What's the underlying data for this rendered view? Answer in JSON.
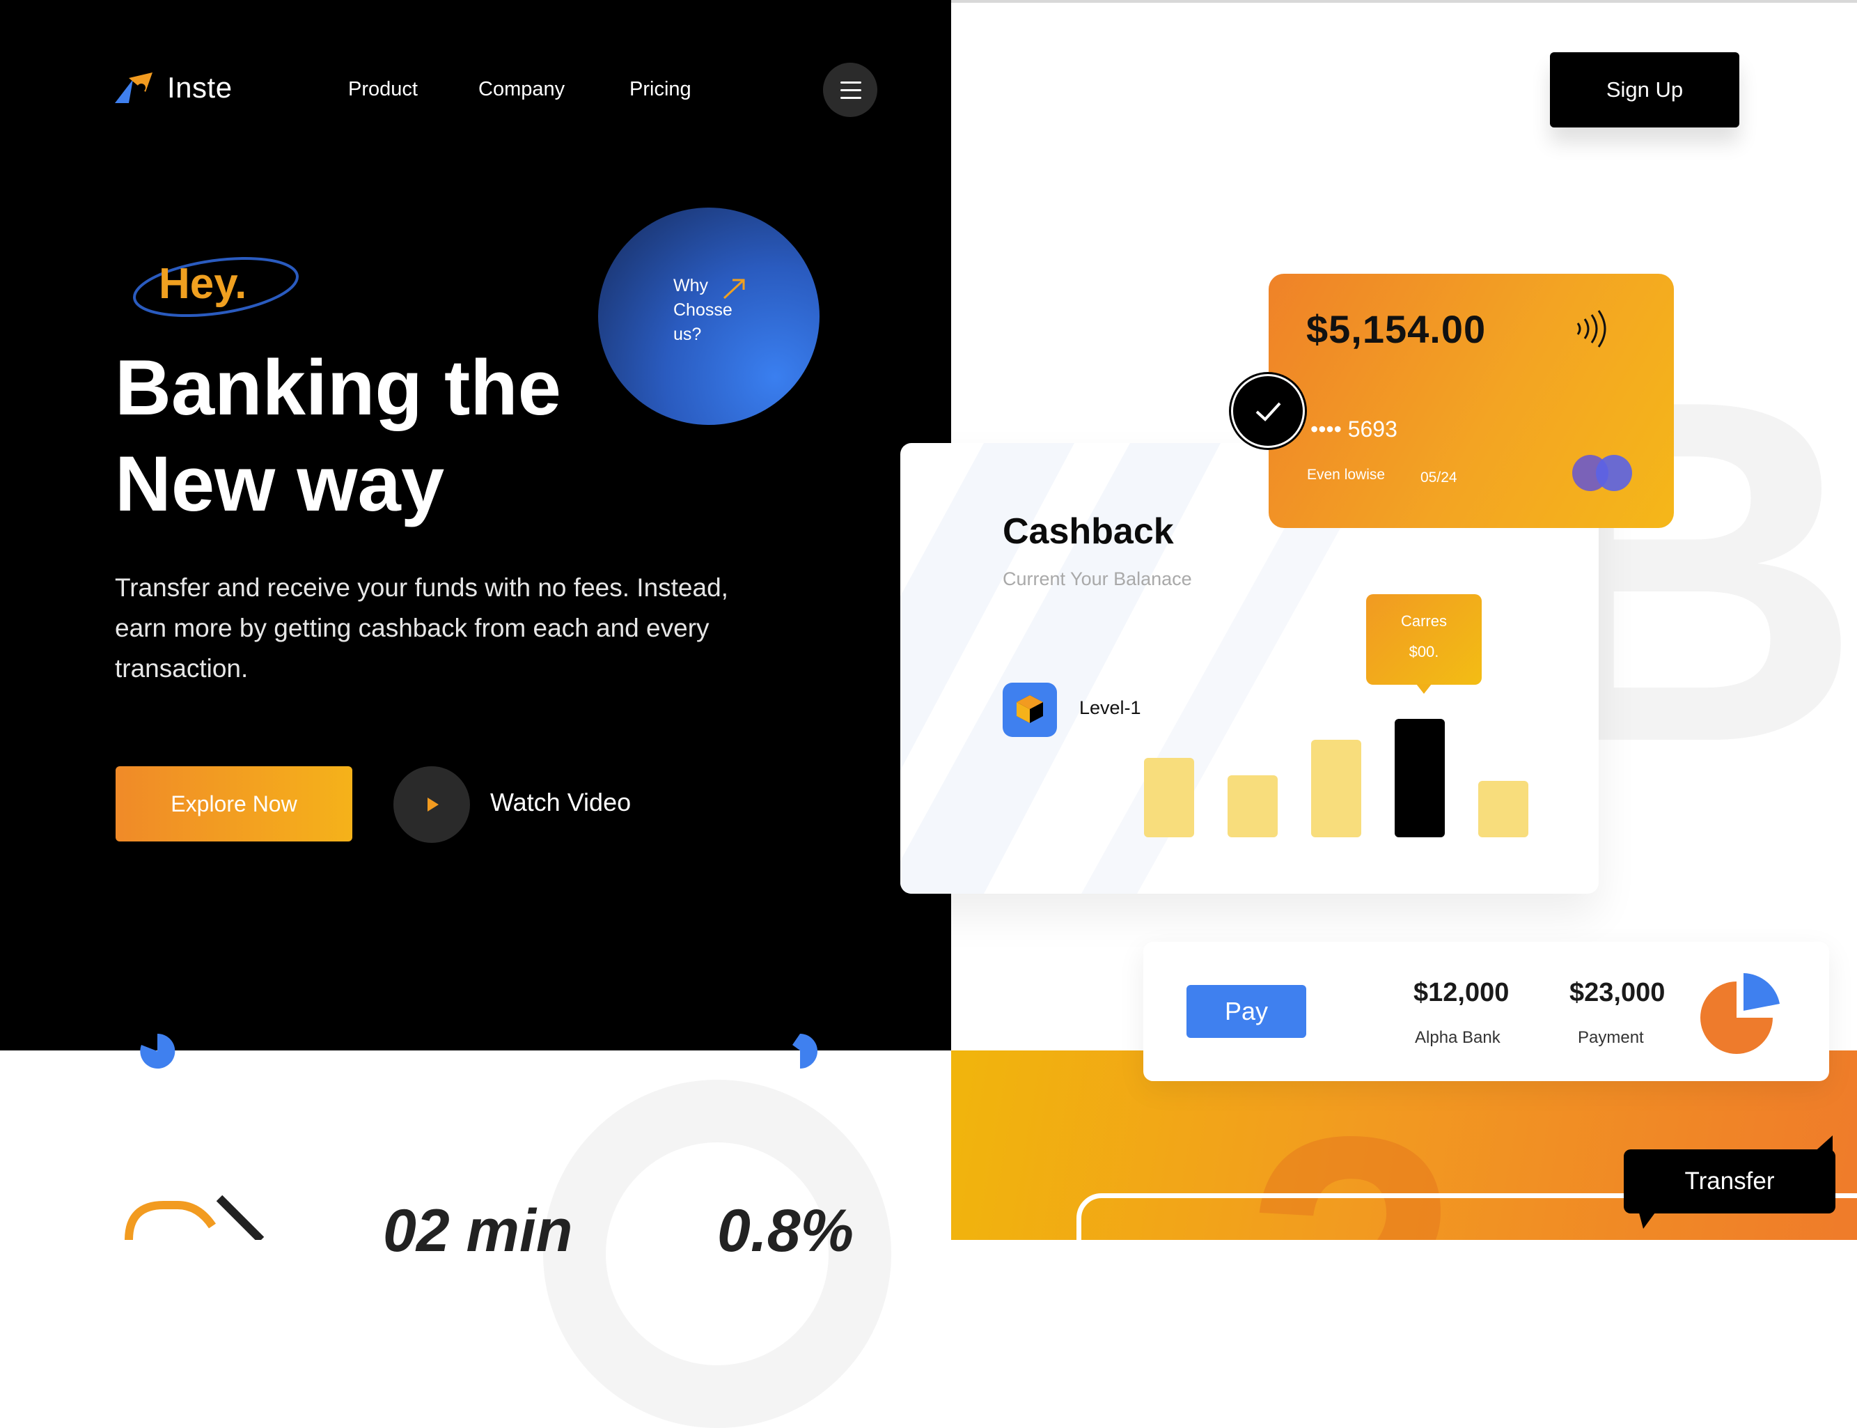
{
  "brand": {
    "name": "Inste",
    "accent": "#f29b20",
    "blue": "#3f80ef"
  },
  "nav": {
    "items": [
      "Product",
      "Company",
      "Pricing"
    ],
    "menu_icon": "hamburger-icon",
    "signup_label": "Sign Up"
  },
  "hero": {
    "greeting": "Hey.",
    "title_line1": "Banking the",
    "title_line2": "New way",
    "why_line1": "Why",
    "why_line2": "Chosse",
    "why_line3": "us?",
    "description": "Transfer and receive your funds with no fees. Instead, earn more by getting cashback from each and every transaction.",
    "explore_label": "Explore Now",
    "watch_label": "Watch Video"
  },
  "cashback": {
    "title": "Cashback",
    "subtitle": "Current  Your Balanace",
    "level": "Level-1",
    "tooltip_line1": "Carres",
    "tooltip_line2": "$00.",
    "bars": [
      0.45,
      0.35,
      0.55,
      0.67,
      0.32
    ],
    "highlight_index": 3
  },
  "credit_card": {
    "balance": "$5,154.00",
    "number": "•••• 5693",
    "holder": "Even lowise",
    "expiry": "05/24",
    "contactless_icon": "contactless-icon",
    "network_icon": "mastercard-icon"
  },
  "payments": {
    "pay_label": "Pay",
    "alpha_amount": "$12,000",
    "alpha_label": "Alpha Bank",
    "payment_amount": "$23,000",
    "payment_label": "Payment"
  },
  "transfer_label": "Transfer",
  "bottom": {
    "stat1": "02 min",
    "stat2": "0.8%"
  }
}
